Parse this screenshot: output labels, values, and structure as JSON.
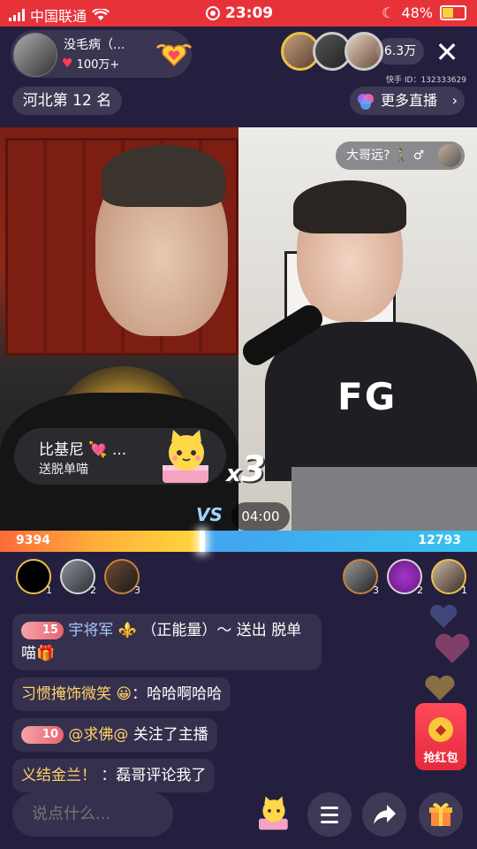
{
  "status_bar": {
    "carrier": "中国联通",
    "time": "23:09",
    "battery": "48%"
  },
  "header": {
    "host_name": "没毛病（...",
    "host_likes": "100万+",
    "viewer_count": "6.3万",
    "account_id": "快手 ID：132333629",
    "rank": "河北第 12 名",
    "more_live": "更多直播"
  },
  "video": {
    "guest_tag": "大哥远? 🚶‍♂️ ♂",
    "gift_sender": "比基尼 💘 ...",
    "gift_text": "送脱单喵",
    "combo_prefix": "x",
    "combo": "3",
    "vs": "VS",
    "timer": "04:00"
  },
  "pk": {
    "left_score": "9394",
    "right_score": "12793",
    "left_fraction": 0.4234
  },
  "rankers": {
    "left": [
      "1",
      "2",
      "3"
    ],
    "right": [
      "3",
      "2",
      "1"
    ]
  },
  "chat": [
    {
      "level": "15",
      "user": "宇将军 ⚜️",
      "text": "（正能量）～ 送出 脱单喵🎁"
    },
    {
      "user": "习惯掩饰微笑 😀",
      "text": "：哈哈啊哈哈"
    },
    {
      "level": "10",
      "user": "@求佛@",
      "text": "关注了主播"
    },
    {
      "user": "义结金兰！",
      "text": "：磊哥评论我了"
    }
  ],
  "red_packet": {
    "label": "抢红包"
  },
  "bottom": {
    "comment_placeholder": "说点什么..."
  },
  "colors": {
    "status_bar": "#e8323a",
    "background": "#241f3e",
    "pk_left": "#ff8a3b",
    "pk_right": "#3ba0f0"
  }
}
